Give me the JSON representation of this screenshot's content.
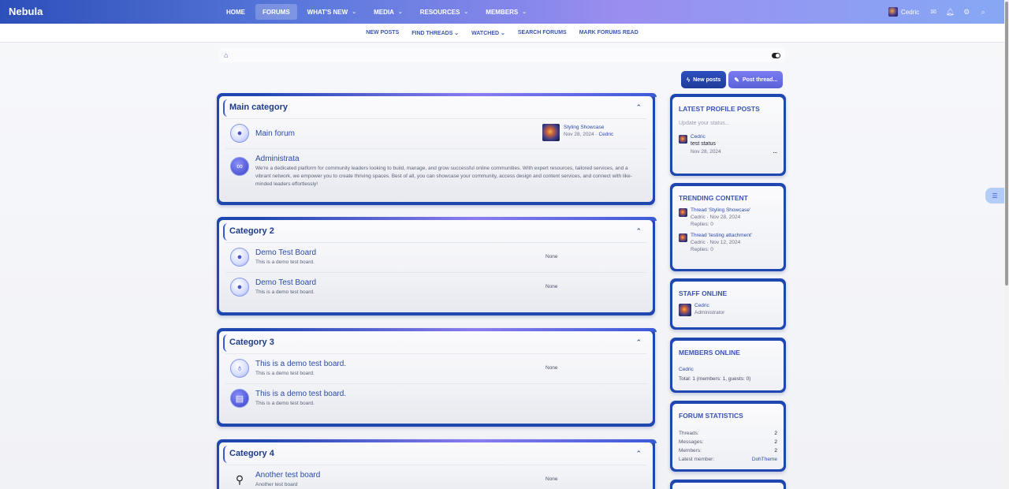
{
  "header": {
    "logo": "Nebula",
    "nav": [
      {
        "label": "HOME",
        "caret": ""
      },
      {
        "label": "FORUMS",
        "caret": ""
      },
      {
        "label": "WHAT'S NEW",
        "caret": "⌄"
      },
      {
        "label": "MEDIA",
        "caret": "⌄"
      },
      {
        "label": "RESOURCES",
        "caret": "⌄"
      },
      {
        "label": "MEMBERS",
        "caret": "⌄"
      }
    ],
    "user": "Cedric"
  },
  "subnav": [
    "NEW POSTS",
    "FIND THREADS ⌄",
    "WATCHED ⌄",
    "SEARCH FORUMS",
    "MARK FORUMS READ"
  ],
  "actions": {
    "new_posts": "New posts",
    "post_thread": "Post thread..."
  },
  "categories": [
    {
      "title": "Main category",
      "nodes": [
        {
          "title": "Main forum",
          "desc": "",
          "last": {
            "thread": "Styling Showcase",
            "date": "Nov 28, 2024",
            "user": "Cedric"
          }
        },
        {
          "title": "Administrata",
          "desc": "We're a dedicated platform for community leaders looking to build, manage, and grow successful online communities. With expert resources, tailored services, and a vibrant network, we empower you to create thriving spaces. Best of all, you can showcase your community, access design and content services, and connect with like-minded leaders effortlessly!"
        }
      ]
    },
    {
      "title": "Category 2",
      "nodes": [
        {
          "title": "Demo Test Board",
          "desc": "This is a demo test board.",
          "none": "None"
        },
        {
          "title": "Demo Test Board",
          "desc": "This is a demo test board.",
          "none": "None"
        }
      ]
    },
    {
      "title": "Category 3",
      "nodes": [
        {
          "title": "This is a demo test board.",
          "desc": "This is a demo test board.",
          "none": "None"
        },
        {
          "title": "This is a demo test board.",
          "desc": "This is a demo test board.",
          "none": "None"
        }
      ]
    },
    {
      "title": "Category 4",
      "nodes": [
        {
          "title": "Another test board",
          "desc": "Another test board",
          "none": "None"
        }
      ]
    }
  ],
  "sidebar": {
    "profile_posts": {
      "title": "LATEST PROFILE POSTS",
      "placeholder": "Update your status...",
      "post": {
        "user": "Cedric",
        "text": "test status",
        "date": "Nov 28, 2024",
        "more": "..."
      }
    },
    "trending": {
      "title": "TRENDING CONTENT",
      "items": [
        {
          "title": "Thread 'Styling Showcase'",
          "meta": "Cedric · Nov 28, 2024",
          "replies": "Replies: 0"
        },
        {
          "title": "Thread 'testing attachment'",
          "meta": "Cedric · Nov 12, 2024",
          "replies": "Replies: 0"
        }
      ]
    },
    "staff": {
      "title": "STAFF ONLINE",
      "user": "Cedric",
      "role": "Administrator"
    },
    "members": {
      "title": "MEMBERS ONLINE",
      "user": "Cedric",
      "total": "Total: 1 (members: 1, guests: 0)"
    },
    "stats": {
      "title": "FORUM STATISTICS",
      "rows": [
        {
          "label": "Threads:",
          "value": "2"
        },
        {
          "label": "Messages:",
          "value": "2"
        },
        {
          "label": "Members:",
          "value": "2"
        },
        {
          "label": "Latest member:",
          "value": "DohTheme"
        }
      ]
    }
  }
}
